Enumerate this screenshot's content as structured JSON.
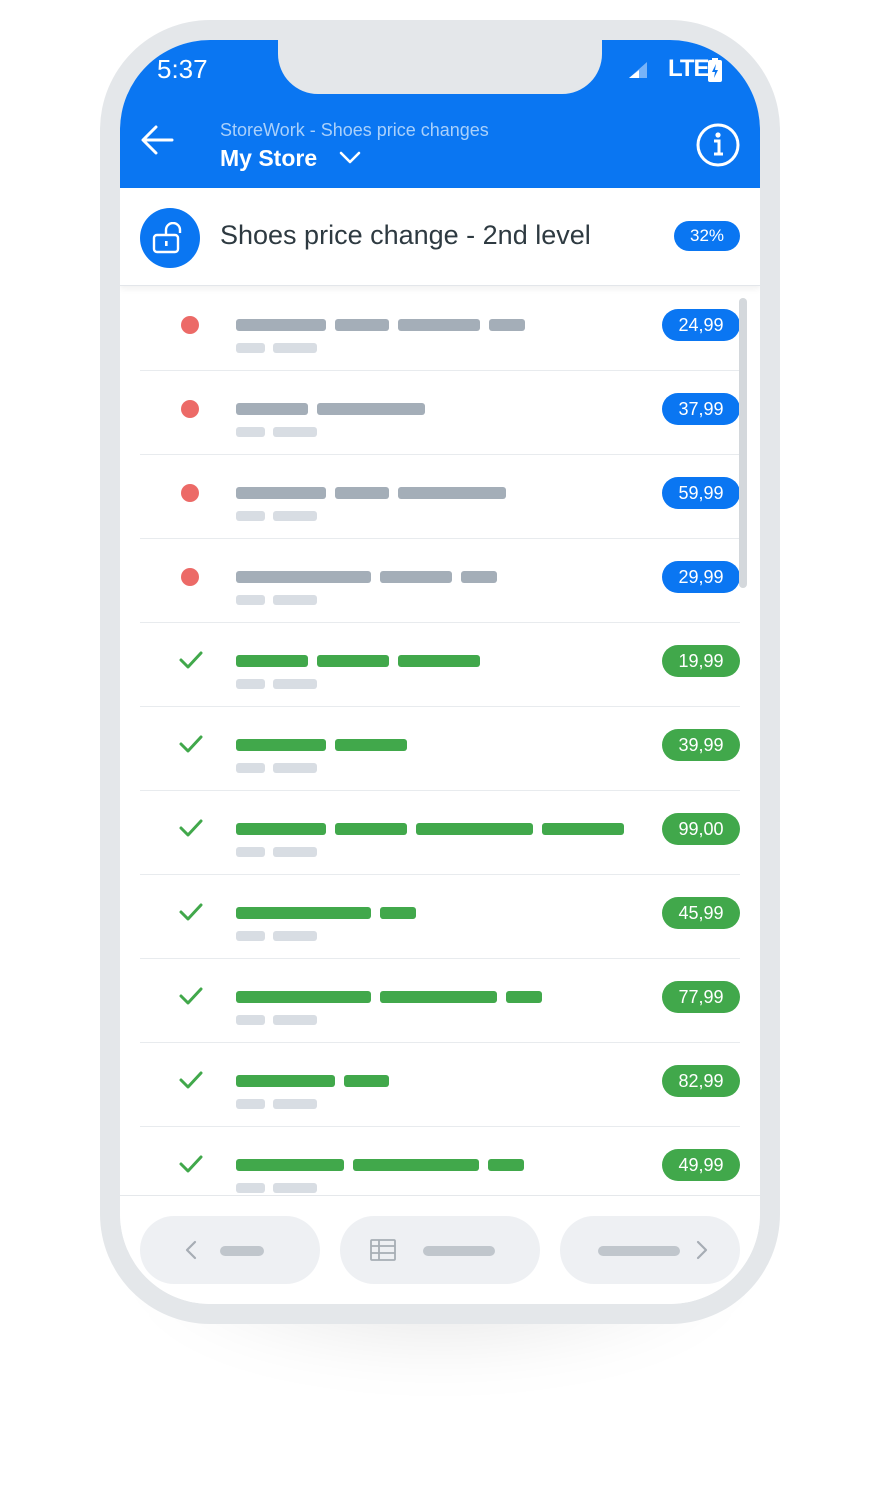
{
  "status_bar": {
    "time": "5:37",
    "network": "LTE"
  },
  "header": {
    "subtitle": "StoreWork - Shoes price changes",
    "store": "My Store"
  },
  "section": {
    "title": "Shoes price change - 2nd level",
    "progress": "32%"
  },
  "items": [
    {
      "status": "pending",
      "price": "24,99"
    },
    {
      "status": "pending",
      "price": "37,99"
    },
    {
      "status": "pending",
      "price": "59,99"
    },
    {
      "status": "pending",
      "price": "29,99"
    },
    {
      "status": "done",
      "price": "19,99"
    },
    {
      "status": "done",
      "price": "39,99"
    },
    {
      "status": "done",
      "price": "99,00"
    },
    {
      "status": "done",
      "price": "45,99"
    },
    {
      "status": "done",
      "price": "77,99"
    },
    {
      "status": "done",
      "price": "82,99"
    },
    {
      "status": "done",
      "price": "49,99"
    }
  ],
  "colors": {
    "accent": "#0a76f2",
    "pending": "#ec6a67",
    "done": "#41a84b"
  },
  "icons": {
    "back": "arrow-left-icon",
    "dropdown": "chevron-down-icon",
    "info": "info-icon",
    "lock": "unlock-icon",
    "check": "check-icon",
    "prev": "chevron-left-icon",
    "table": "table-icon",
    "next": "chevron-right-icon"
  }
}
